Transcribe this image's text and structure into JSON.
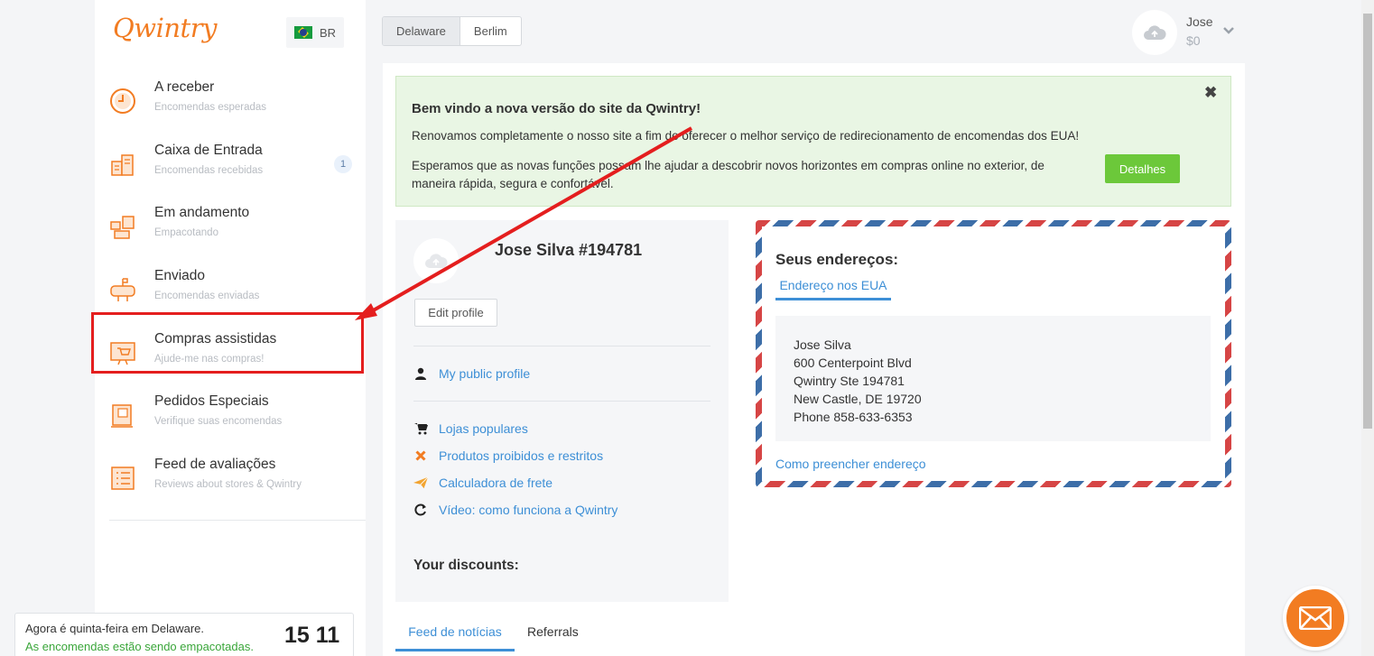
{
  "brand": {
    "logo": "Qwintry",
    "lang": "BR"
  },
  "sidebar": {
    "items": [
      {
        "title": "A receber",
        "sub": "Encomendas esperadas"
      },
      {
        "title": "Caixa de Entrada",
        "sub": "Encomendas recebidas",
        "badge": "1"
      },
      {
        "title": "Em andamento",
        "sub": "Empacotando"
      },
      {
        "title": "Enviado",
        "sub": "Encomendas enviadas"
      },
      {
        "title": "Compras assistidas",
        "sub": "Ajude-me nas compras!"
      },
      {
        "title": "Pedidos Especiais",
        "sub": "Verifique suas encomendas"
      },
      {
        "title": "Feed de avaliações",
        "sub": "Reviews about stores & Qwintry"
      }
    ]
  },
  "clock": {
    "line1": "Agora é quinta-feira em Delaware.",
    "line2": "As encomendas estão sendo empacotadas.",
    "time": "15 11"
  },
  "warehouse_tabs": [
    "Delaware",
    "Berlim"
  ],
  "user": {
    "name": "Jose",
    "balance": "$0"
  },
  "welcome": {
    "title": "Bem vindo a nova versão do site da Qwintry!",
    "line1": "Renovamos completamente o nosso site a fim de oferecer o melhor serviço de redirecionamento de encomendas dos EUA!",
    "line2": "Esperamos que as novas funções possam lhe ajudar a descobrir novos horizontes em compras online no exterior, de maneira rápida, segura e confortável.",
    "button": "Detalhes",
    "close": "✖"
  },
  "profile": {
    "name": "Jose Silva #194781",
    "edit": "Edit profile",
    "public_link": "My public profile",
    "links": [
      "Lojas populares",
      "Produtos proibidos e restritos",
      "Calculadora de frete",
      "Vídeo: como funciona a Qwintry"
    ],
    "discounts": "Your discounts:"
  },
  "address": {
    "title": "Seus endereços:",
    "tab": "Endereço nos EUA",
    "lines": [
      "Jose Silva",
      "600 Centerpoint Blvd",
      "Qwintry Ste 194781",
      "New Castle, DE 19720",
      "Phone 858-633-6353"
    ],
    "how": "Como preencher endereço"
  },
  "bottom_tabs": {
    "news": "Feed de notícias",
    "referrals": "Referrals"
  },
  "colors": {
    "brand": "#f27c22",
    "link": "#3d8fd6",
    "success": "#6cc83a",
    "annotation": "#e41e1e"
  }
}
